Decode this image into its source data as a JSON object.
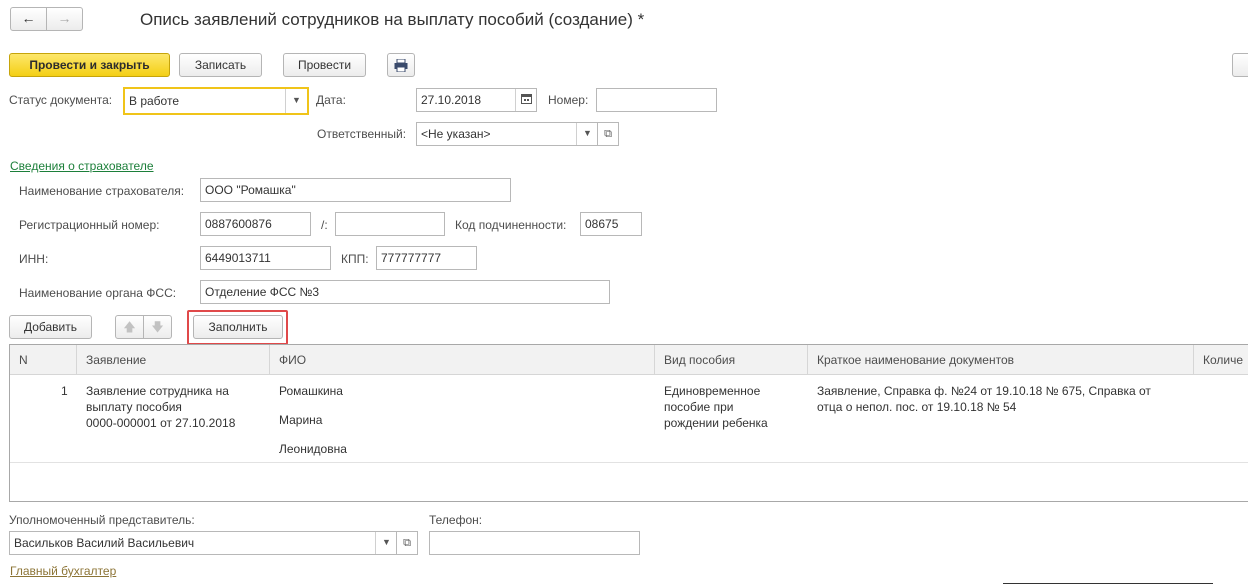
{
  "form": {
    "title": "Опись заявлений сотрудников на выплату пособий (создание) *",
    "nav": {
      "back_icon": "←",
      "forward_icon": "→"
    },
    "toolbar": {
      "post_close_label": "Провести и закрыть",
      "save_label": "Записать",
      "post_label": "Провести",
      "print_icon": "printer-icon"
    },
    "status": {
      "label": "Статус документа:",
      "value": "В работе"
    },
    "date": {
      "label": "Дата:",
      "value": "27.10.2018"
    },
    "number": {
      "label": "Номер:",
      "value": ""
    },
    "responsible": {
      "label": "Ответственный:",
      "value": "<Не указан>"
    },
    "insurer_section": {
      "link": "Сведения о страхователе",
      "name_label": "Наименование страхователя:",
      "name_value": "ООО \"Ромашка\"",
      "reg_label": "Регистрационный номер:",
      "reg_value": "0887600876",
      "reg_sep": "/:",
      "reg_value2": "",
      "sub_code_label": "Код подчиненности:",
      "sub_code_value": "08675",
      "inn_label": "ИНН:",
      "inn_value": "6449013711",
      "kpp_label": "КПП:",
      "kpp_value": "777777777",
      "fss_label": "Наименование органа ФСС:",
      "fss_value": "Отделение ФСС №3"
    },
    "table_toolbar": {
      "add_label": "Добавить",
      "fill_label": "Заполнить"
    },
    "table": {
      "columns": [
        "N",
        "Заявление",
        "ФИО",
        "Вид пособия",
        "Краткое наименование документов",
        "Количе"
      ],
      "rows": [
        {
          "n": "1",
          "statement": [
            "Заявление сотрудника на",
            "выплату пособия",
            "0000-000001 от 27.10.2018"
          ],
          "fio": [
            "Ромашкина",
            "Марина",
            "Леонидовна"
          ],
          "benefit": [
            "Единовременное",
            "пособие при",
            "рождении ребенка"
          ],
          "docs": [
            "Заявление, Справка ф. №24 от 19.10.18 № 675, Справка от",
            "отца о непол. пос. от 19.10.18 № 54"
          ]
        }
      ]
    },
    "representative": {
      "label": "Уполномоченный представитель:",
      "value": "Васильков Василий Васильевич"
    },
    "phone": {
      "label": "Телефон:",
      "value": ""
    },
    "chief_accountant_link": "Главный бухгалтер",
    "colors": {
      "accent_yellow": "#f4cf15",
      "link_green": "#1c7f3a",
      "link_olive": "#8c7436",
      "highlight_red": "#e0494a"
    }
  }
}
